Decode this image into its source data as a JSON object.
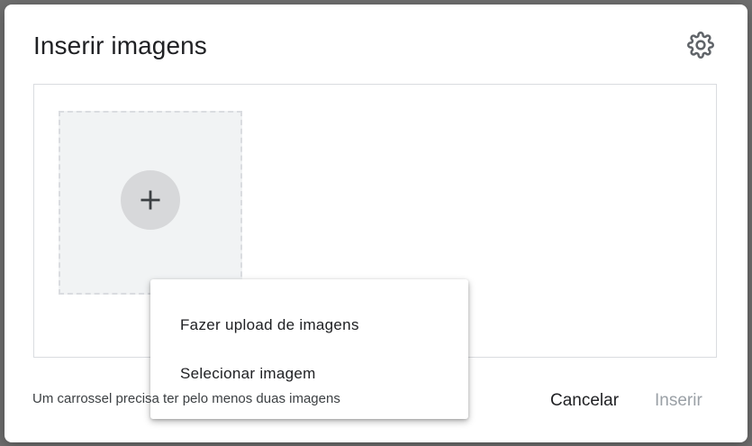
{
  "dialog": {
    "title": "Inserir imagens",
    "settings_icon": "gear-icon"
  },
  "upload_tile": {
    "icon": "plus-icon"
  },
  "menu": {
    "items": [
      {
        "label": "Fazer upload de imagens"
      },
      {
        "label": "Selecionar imagem"
      }
    ]
  },
  "footer": {
    "note": "Um carrossel precisa ter pelo menos duas imagens",
    "cancel_label": "Cancelar",
    "insert_label": "Inserir"
  },
  "colors": {
    "text_primary": "#202124",
    "text_disabled": "#9aa0a6",
    "tile_bg": "#f1f3f4",
    "border": "#dadce0"
  }
}
